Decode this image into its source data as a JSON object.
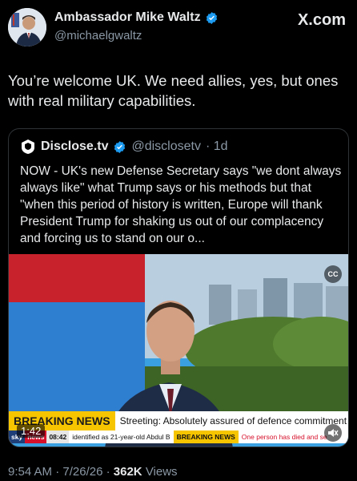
{
  "header": {
    "display_name": "Ambassador Mike Waltz",
    "handle": "@michaelgwaltz",
    "site": "X.com"
  },
  "tweet": {
    "text": "You’re welcome UK. We need allies, yes, but ones with real military capabilities."
  },
  "quote": {
    "name": "Disclose.tv",
    "handle": "@disclosetv",
    "age": "· 1d",
    "text": "NOW - UK's new Defense Secretary says \"we dont always always like\" what Trump says or his methods but that \"when this period of history is written, Europe will thank President Trump for shaking us out of our complacency and forcing us to stand on our o...",
    "video": {
      "cc_label": "CC",
      "breaking_label": "BREAKING NEWS",
      "headline": "Streeting: Absolutely assured of defence commitment",
      "ticker_sky": "sky",
      "ticker_news": "news",
      "ticker_time": "08:42",
      "ticker_text_1": "identified as 21-year-old Abdul B",
      "ticker_breaking": "BREAKING NEWS",
      "ticker_text_2": "One person has died and se",
      "duration": "1:42",
      "mute_icon": "speaker-muted-icon"
    }
  },
  "footer": {
    "time": "9:54 AM",
    "date": "7/26/26",
    "views_count": "362K",
    "views_label": "Views"
  },
  "colors": {
    "background": "#000000",
    "verified_blue": "#1d9bf0",
    "breaking_yellow": "#f7c400",
    "sky_red": "#d6102b"
  }
}
